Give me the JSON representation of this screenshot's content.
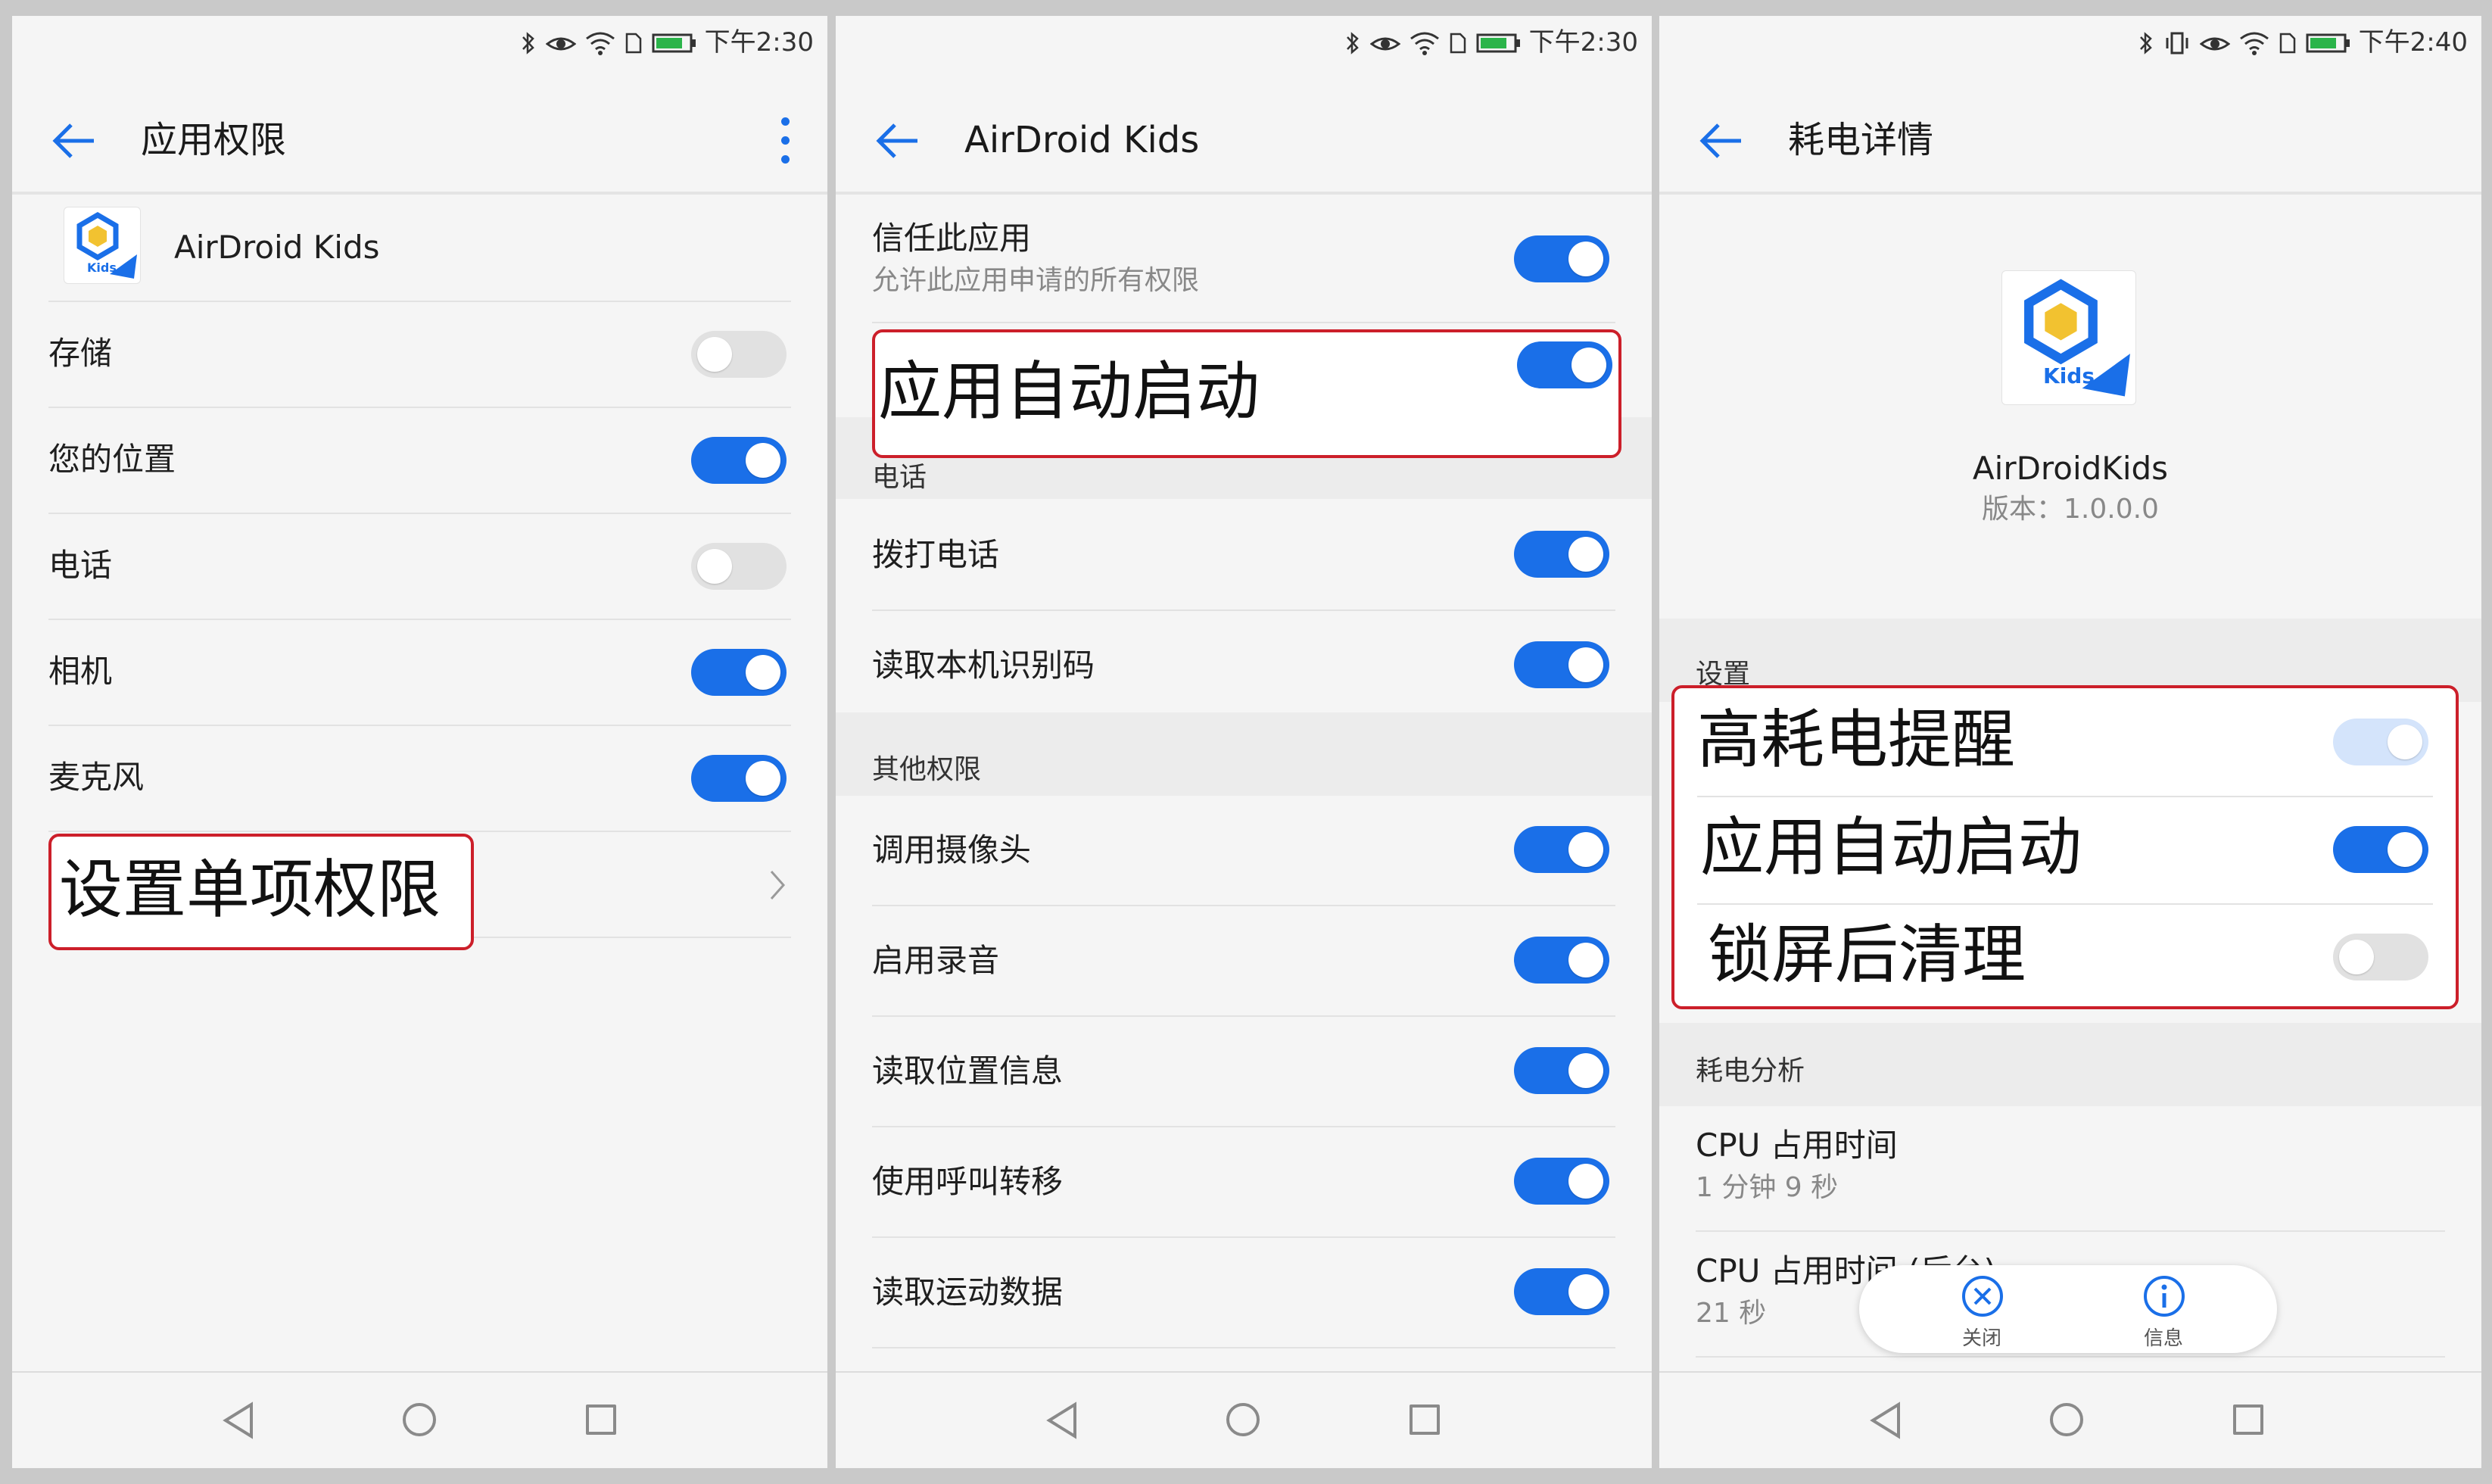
{
  "status": {
    "time_left": "下午2:30",
    "time_mid": "下午2:30",
    "time_right": "下午2:40"
  },
  "panel1": {
    "title": "应用权限",
    "app_name": "AirDroid Kids",
    "app_icon_text": "Kids",
    "permissions": [
      {
        "label": "存储",
        "enabled": false
      },
      {
        "label": "您的位置",
        "enabled": true
      },
      {
        "label": "电话",
        "enabled": false
      },
      {
        "label": "相机",
        "enabled": true
      },
      {
        "label": "麦克风",
        "enabled": true
      }
    ],
    "single_permission": "设置单项权限"
  },
  "panel2": {
    "title": "AirDroid Kids",
    "trust_label": "信任此应用",
    "trust_desc": "允许此应用申请的所有权限",
    "autostart_label": "应用自动启动",
    "phone_header": "电话",
    "phone_items": [
      {
        "label": "拨打电话",
        "enabled": true
      },
      {
        "label": "读取本机识别码",
        "enabled": true
      }
    ],
    "other_header": "其他权限",
    "other_items": [
      {
        "label": "调用摄像头",
        "enabled": true
      },
      {
        "label": "启用录音",
        "enabled": true
      },
      {
        "label": "读取位置信息",
        "enabled": true
      },
      {
        "label": "使用呼叫转移",
        "enabled": true
      },
      {
        "label": "读取运动数据",
        "enabled": true
      }
    ]
  },
  "panel3": {
    "title": "耗电详情",
    "app_name": "AirDroidKids",
    "app_icon_text": "Kids",
    "version": "版本：1.0.0.0",
    "settings_header": "设置",
    "settings": [
      {
        "label": "高耗电提醒",
        "enabled": true,
        "disabled": true
      },
      {
        "label": "应用自动启动",
        "enabled": true
      },
      {
        "label": "锁屏后清理",
        "enabled": false
      }
    ],
    "analysis_header": "耗电分析",
    "cpu_label": "CPU 占用时间",
    "cpu_value": "1 分钟 9 秒",
    "cpu_bg_label": "CPU 占用时间 (后台)",
    "cpu_bg_value": "21 秒",
    "popup_close": "关闭",
    "popup_info": "信息"
  },
  "colors": {
    "accent": "#1a6fe8",
    "highlight": "#cc1f2a",
    "background": "#f5f5f5"
  }
}
